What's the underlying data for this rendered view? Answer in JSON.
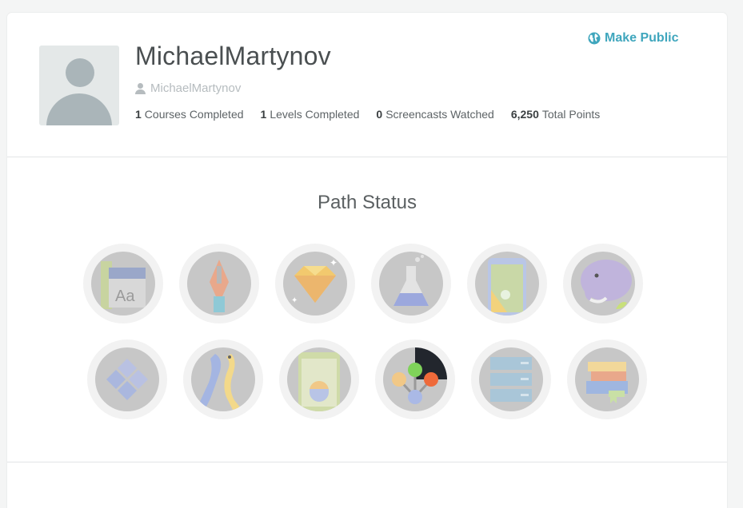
{
  "profile": {
    "name": "MichaelMartynov",
    "username": "MichaelMartynov",
    "make_public_label": "Make Public",
    "stats": [
      {
        "value": "1",
        "label": "Courses Completed"
      },
      {
        "value": "1",
        "label": "Levels Completed"
      },
      {
        "value": "0",
        "label": "Screencasts Watched"
      },
      {
        "value": "6,250",
        "label": "Total Points"
      }
    ]
  },
  "path_status": {
    "title": "Path Status",
    "badges": [
      {
        "icon": "html-css-typography-icon"
      },
      {
        "icon": "pen-nib-design-icon"
      },
      {
        "icon": "ruby-gem-icon"
      },
      {
        "icon": "chemistry-flask-icon"
      },
      {
        "icon": "ios-touch-phone-icon"
      },
      {
        "icon": "php-elephant-icon"
      },
      {
        "icon": "diamond-tiles-icon"
      },
      {
        "icon": "python-snakes-icon"
      },
      {
        "icon": "android-phone-icon"
      },
      {
        "icon": "molecule-nodes-icon"
      },
      {
        "icon": "database-server-icon"
      },
      {
        "icon": "books-stack-icon"
      }
    ]
  },
  "colors": {
    "accent": "#3fa6bd",
    "badge_inactive": "#c7c7c7",
    "badge_ring": "#f2f2f2"
  }
}
